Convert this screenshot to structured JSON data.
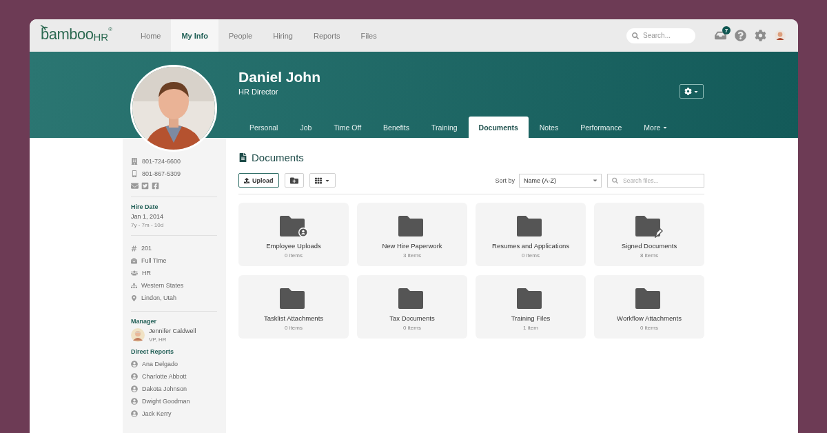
{
  "logo": {
    "word": "bamboo",
    "suffix": "HR",
    "mark": "®"
  },
  "nav": [
    {
      "label": "Home",
      "selected": false
    },
    {
      "label": "My Info",
      "selected": true
    },
    {
      "label": "People",
      "selected": false
    },
    {
      "label": "Hiring",
      "selected": false
    },
    {
      "label": "Reports",
      "selected": false
    },
    {
      "label": "Files",
      "selected": false
    }
  ],
  "search": {
    "placeholder": "Search..."
  },
  "inbox": {
    "badge": "7"
  },
  "profile": {
    "name": "Daniel John",
    "title": "HR Director"
  },
  "tabs": [
    {
      "label": "Personal",
      "selected": false
    },
    {
      "label": "Job",
      "selected": false
    },
    {
      "label": "Time Off",
      "selected": false
    },
    {
      "label": "Benefits",
      "selected": false
    },
    {
      "label": "Training",
      "selected": false
    },
    {
      "label": "Documents",
      "selected": true
    },
    {
      "label": "Notes",
      "selected": false
    },
    {
      "label": "Performance",
      "selected": false
    },
    {
      "label": "More",
      "selected": false,
      "kind": "menu"
    }
  ],
  "sidebar": {
    "phones": [
      {
        "kind": "work",
        "number": "801-724-6600"
      },
      {
        "kind": "mobile",
        "number": "801-867-5309"
      }
    ],
    "hire_date": {
      "label": "Hire Date",
      "date": "Jan 1, 2014",
      "length": "7y - 7m - 10d"
    },
    "details": [
      {
        "kind": "number",
        "text": "201"
      },
      {
        "kind": "status",
        "text": "Full Time"
      },
      {
        "kind": "department",
        "text": "HR"
      },
      {
        "kind": "division",
        "text": "Western States"
      },
      {
        "kind": "location",
        "text": "Lindon, Utah"
      }
    ],
    "manager": {
      "label": "Manager",
      "name": "Jennifer Caldwell",
      "title": "VP, HR"
    },
    "direct_reports": {
      "label": "Direct Reports",
      "people": [
        "Ana Delgado",
        "Charlotte Abbott",
        "Dakota Johnson",
        "Dwight Goodman",
        "Jack Kerry"
      ]
    }
  },
  "documents": {
    "title": "Documents",
    "upload": "Upload",
    "sort_label": "Sort by",
    "sort_value": "Name (A-Z)",
    "search_placeholder": "Search files...",
    "folders": [
      {
        "name": "Employee Uploads",
        "count": "0 items",
        "kind": "shared"
      },
      {
        "name": "New Hire Paperwork",
        "count": "3 items",
        "kind": "plain"
      },
      {
        "name": "Resumes and Applications",
        "count": "0 items",
        "kind": "plain"
      },
      {
        "name": "Signed Documents",
        "count": "8 items",
        "kind": "signed"
      },
      {
        "name": "Tasklist Attachments",
        "count": "0 items",
        "kind": "plain"
      },
      {
        "name": "Tax Documents",
        "count": "0 items",
        "kind": "plain"
      },
      {
        "name": "Training Files",
        "count": "1 item",
        "kind": "plain"
      },
      {
        "name": "Workflow Attachments",
        "count": "0 items",
        "kind": "plain"
      }
    ]
  }
}
